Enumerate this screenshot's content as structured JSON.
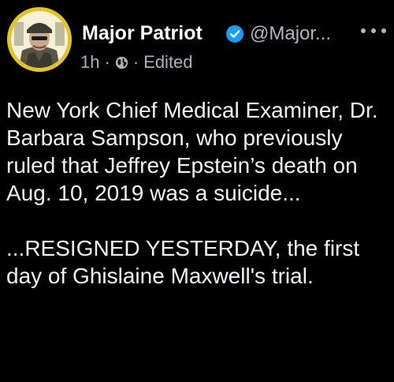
{
  "post": {
    "author": {
      "name": "Major Patriot",
      "handle": "@Major...",
      "verified": true,
      "avatar_icon": "avatar-soldier-portrait"
    },
    "meta": {
      "time": "1h",
      "separator": "·",
      "audience_icon": "globe-icon",
      "edited_label": "Edited"
    },
    "more_icon": "more-horizontal-icon",
    "paragraphs": [
      "New York Chief Medical Examiner, Dr. Barbara Sampson, who previously ruled that Jeffrey Epstein’s death on Aug. 10, 2019 was a suicide...",
      "...RESIGNED YESTERDAY, the first day of Ghislaine Maxwell's trial."
    ]
  },
  "colors": {
    "background": "#000000",
    "avatar_ring": "#e4c326",
    "verified": "#1d9bf0",
    "secondary_text": "#b3b6bc"
  }
}
